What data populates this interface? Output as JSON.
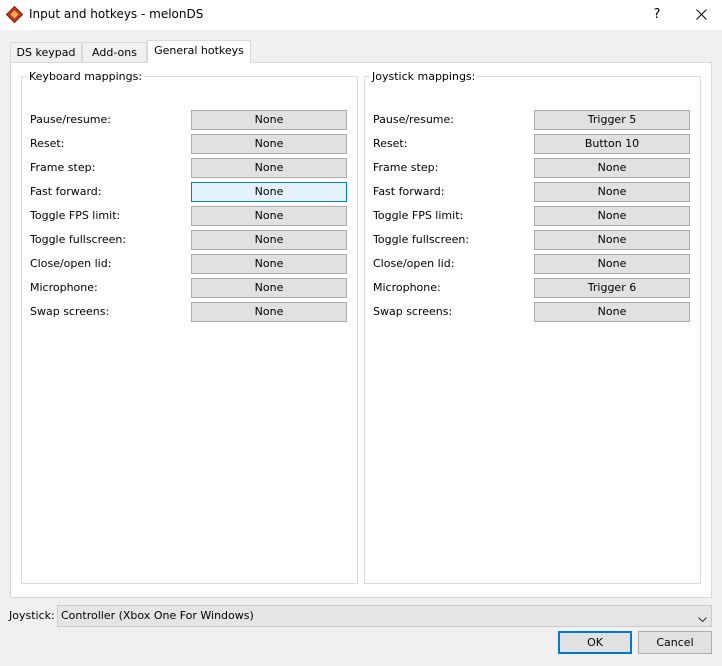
{
  "window": {
    "title": "Input and hotkeys - melonDS",
    "help_label": "?"
  },
  "tabs": [
    {
      "label": "DS keypad",
      "active": false
    },
    {
      "label": "Add-ons",
      "active": false
    },
    {
      "label": "General hotkeys",
      "active": true
    }
  ],
  "keyboard": {
    "title": "Keyboard mappings:",
    "rows": [
      {
        "label": "Pause/resume:",
        "value": "None"
      },
      {
        "label": "Reset:",
        "value": "None"
      },
      {
        "label": "Frame step:",
        "value": "None"
      },
      {
        "label": "Fast forward:",
        "value": "None",
        "focused": true
      },
      {
        "label": "Toggle FPS limit:",
        "value": "None"
      },
      {
        "label": "Toggle fullscreen:",
        "value": "None"
      },
      {
        "label": "Close/open lid:",
        "value": "None"
      },
      {
        "label": "Microphone:",
        "value": "None"
      },
      {
        "label": "Swap screens:",
        "value": "None"
      }
    ]
  },
  "joystick_map": {
    "title": "Joystick mappings:",
    "rows": [
      {
        "label": "Pause/resume:",
        "value": "Trigger 5"
      },
      {
        "label": "Reset:",
        "value": "Button 10"
      },
      {
        "label": "Frame step:",
        "value": "None"
      },
      {
        "label": "Fast forward:",
        "value": "None"
      },
      {
        "label": "Toggle FPS limit:",
        "value": "None"
      },
      {
        "label": "Toggle fullscreen:",
        "value": "None"
      },
      {
        "label": "Close/open lid:",
        "value": "None"
      },
      {
        "label": "Microphone:",
        "value": "Trigger 6"
      },
      {
        "label": "Swap screens:",
        "value": "None"
      }
    ]
  },
  "joystick": {
    "label": "Joystick:",
    "selected": "Controller (Xbox One For Windows)"
  },
  "buttons": {
    "ok": "OK",
    "cancel": "Cancel"
  },
  "icons": {
    "app": "melonds-app-icon",
    "close": "close-icon",
    "dropdown": "chevron-down-icon"
  },
  "colors": {
    "accent": "#0078d7",
    "button_face": "#e1e1e1",
    "focus_fill": "#e5f1fb"
  }
}
